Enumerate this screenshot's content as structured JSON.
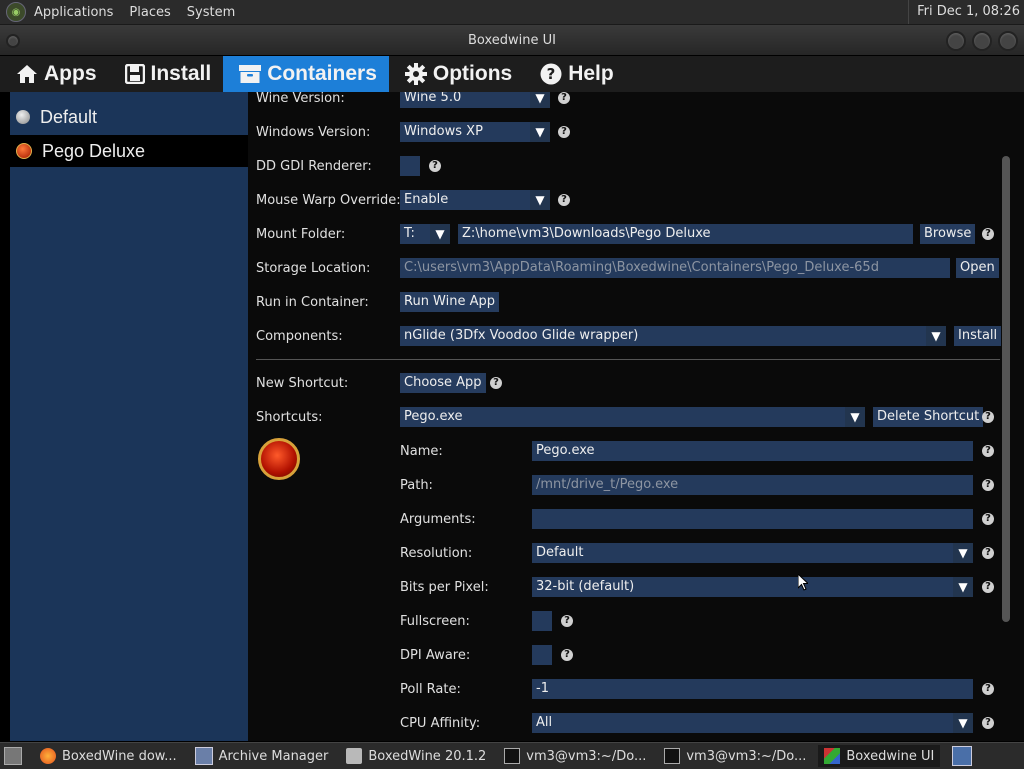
{
  "topbar": {
    "menus": [
      "Applications",
      "Places",
      "System"
    ],
    "clock": "Fri Dec 1, 08:26"
  },
  "window": {
    "title": "Boxedwine UI"
  },
  "tabs": [
    {
      "label": "Apps",
      "icon": "home-icon"
    },
    {
      "label": "Install",
      "icon": "save-icon"
    },
    {
      "label": "Containers",
      "icon": "box-icon",
      "active": true
    },
    {
      "label": "Options",
      "icon": "gear-icon"
    },
    {
      "label": "Help",
      "icon": "question-icon"
    }
  ],
  "sidebar": {
    "items": [
      {
        "label": "Default",
        "icon": "gray-dot-icon",
        "selected": false
      },
      {
        "label": "Pego Deluxe",
        "icon": "red-dot-icon",
        "selected": true
      }
    ]
  },
  "form": {
    "wine_version": {
      "label": "Wine Version:",
      "value": "Wine 5.0"
    },
    "windows_version": {
      "label": "Windows Version:",
      "value": "Windows XP"
    },
    "dd_gdi": {
      "label": "DD GDI Renderer:"
    },
    "mouse_warp": {
      "label": "Mouse Warp Override:",
      "value": "Enable"
    },
    "mount_folder": {
      "label": "Mount Folder:",
      "drive": "T:",
      "path": "Z:\\home\\vm3\\Downloads\\Pego Deluxe",
      "browse": "Browse"
    },
    "storage": {
      "label": "Storage Location:",
      "path": "C:\\users\\vm3\\AppData\\Roaming\\Boxedwine\\Containers\\Pego_Deluxe-65d",
      "open": "Open"
    },
    "run": {
      "label": "Run in Container:",
      "button": "Run Wine App"
    },
    "components": {
      "label": "Components:",
      "value": "nGlide (3Dfx Voodoo Glide wrapper)",
      "install": "Install"
    },
    "new_shortcut": {
      "label": "New Shortcut:",
      "button": "Choose App"
    },
    "shortcuts": {
      "label": "Shortcuts:",
      "value": "Pego.exe",
      "delete": "Delete Shortcut"
    },
    "name": {
      "label": "Name:",
      "value": "Pego.exe"
    },
    "path": {
      "label": "Path:",
      "value": "/mnt/drive_t/Pego.exe"
    },
    "arguments": {
      "label": "Arguments:",
      "value": ""
    },
    "resolution": {
      "label": "Resolution:",
      "value": "Default"
    },
    "bpp": {
      "label": "Bits per Pixel:",
      "value": "32-bit (default)"
    },
    "fullscreen": {
      "label": "Fullscreen:"
    },
    "dpi": {
      "label": "DPI Aware:"
    },
    "poll": {
      "label": "Poll Rate:",
      "value": "-1"
    },
    "affinity": {
      "label": "CPU Affinity:",
      "value": "All"
    }
  },
  "taskbar": [
    {
      "label": "BoxedWine dow...",
      "icon": "firefox-icon"
    },
    {
      "label": "Archive Manager",
      "icon": "archive-icon"
    },
    {
      "label": "BoxedWine 20.1.2",
      "icon": "folder-icon"
    },
    {
      "label": "vm3@vm3:~/Do...",
      "icon": "terminal-icon"
    },
    {
      "label": "vm3@vm3:~/Do...",
      "icon": "terminal-icon"
    },
    {
      "label": "Boxedwine UI",
      "icon": "boxedwine-icon",
      "active": true
    }
  ],
  "colors": {
    "accent": "#1d7fd8",
    "panel": "#1b3559",
    "field": "#243a5c"
  }
}
